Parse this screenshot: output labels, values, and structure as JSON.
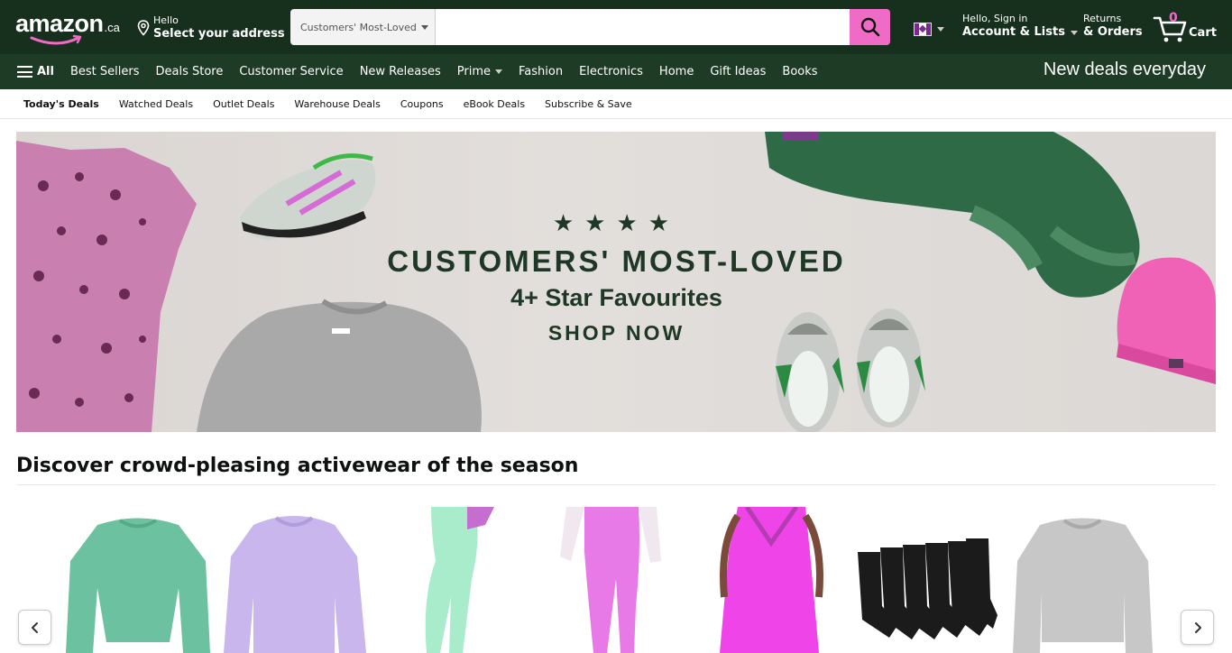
{
  "header": {
    "logo_word": "amazon",
    "logo_tld": ".ca",
    "address_line1": "Hello",
    "address_line2": "Select your address",
    "search_category": "Customers' Most-Loved",
    "search_placeholder": "",
    "account_line1": "Hello, Sign in",
    "account_line2": "Account & Lists",
    "returns_line1": "Returns",
    "returns_line2": "& Orders",
    "cart_count": "0",
    "cart_label": "Cart",
    "icons": {
      "location": "location-pin-icon",
      "search": "search-icon",
      "flag": "canada-flag-icon",
      "cart": "cart-icon"
    },
    "colors": {
      "header_bg": "#17301e",
      "search_button": "#f06bc6",
      "cart_count": "#f06bc6"
    }
  },
  "nav": {
    "all_label": "All",
    "items": [
      "Best Sellers",
      "Deals Store",
      "Customer Service",
      "New Releases",
      "Prime",
      "Fashion",
      "Electronics",
      "Home",
      "Gift Ideas",
      "Books"
    ],
    "promo": "New deals everyday",
    "colors": {
      "bg": "#1d3b25"
    }
  },
  "subnav": {
    "items": [
      "Today's Deals",
      "Watched Deals",
      "Outlet Deals",
      "Warehouse Deals",
      "Coupons",
      "eBook Deals",
      "Subscribe & Save"
    ]
  },
  "hero": {
    "stars": "★★★★",
    "title": "CUSTOMERS' MOST-LOVED",
    "subtitle": "4+ Star Favourites",
    "cta": "SHOP NOW",
    "colors": {
      "text": "#1f3826"
    }
  },
  "activewear": {
    "title": "Discover crowd-pleasing activewear of the season",
    "products": [
      "green cropped sweatshirt",
      "lavender sweatshirt",
      "mint leggings",
      "pink joggers",
      "pink tank top",
      "black socks",
      "grey sweatshirt"
    ]
  }
}
